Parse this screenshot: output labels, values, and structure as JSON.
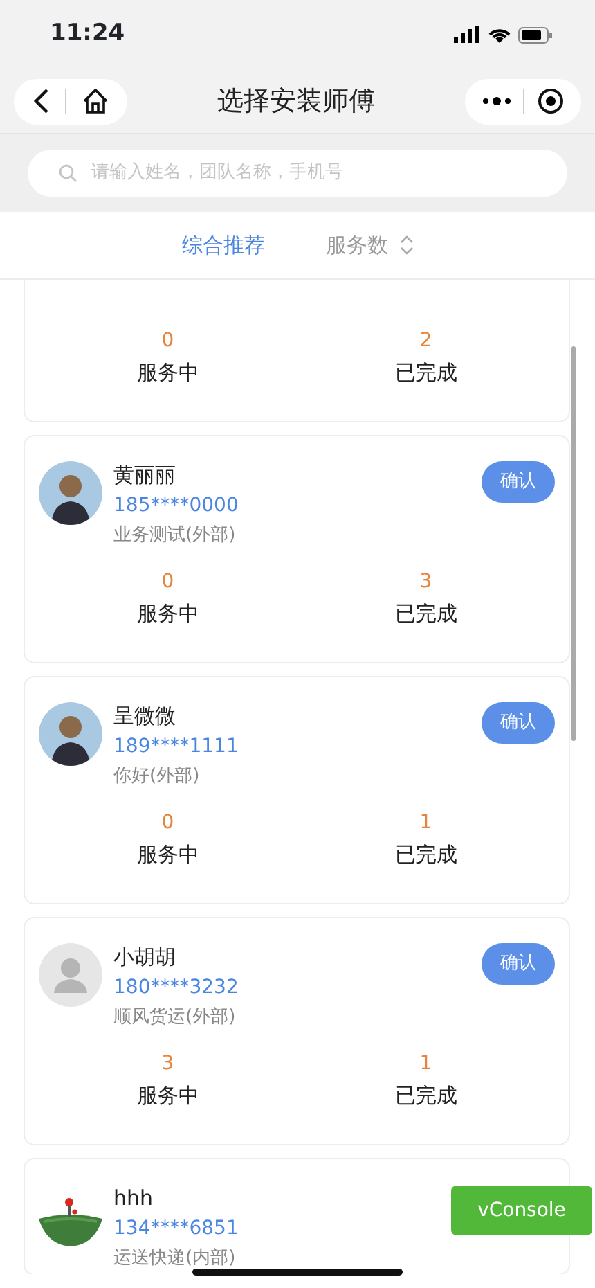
{
  "status_bar": {
    "time": "11:24"
  },
  "nav": {
    "title": "选择安装师傅"
  },
  "search": {
    "placeholder": "请输入姓名，团队名称，手机号"
  },
  "sort_tabs": [
    {
      "label": "综合推荐",
      "selected": true,
      "kind": "plain"
    },
    {
      "label": "服务数",
      "selected": false,
      "kind": "sortable"
    }
  ],
  "workers": [
    {
      "kind": "partial",
      "stats": [
        {
          "value": "0",
          "label": "服务中"
        },
        {
          "value": "2",
          "label": "已完成"
        }
      ]
    },
    {
      "kind": "full",
      "avatar": {
        "kind": "figure"
      },
      "name": "黄丽丽",
      "phone": "185****0000",
      "team": "业务测试(外部)",
      "button": "确认",
      "stats": [
        {
          "value": "0",
          "label": "服务中"
        },
        {
          "value": "3",
          "label": "已完成"
        }
      ]
    },
    {
      "kind": "full",
      "avatar": {
        "kind": "figure"
      },
      "name": "呈微微",
      "phone": "189****1111",
      "team": "你好(外部)",
      "button": "确认",
      "stats": [
        {
          "value": "0",
          "label": "服务中"
        },
        {
          "value": "1",
          "label": "已完成"
        }
      ]
    },
    {
      "kind": "full",
      "avatar": {
        "kind": "default"
      },
      "name": "小胡胡",
      "phone": "180****3232",
      "team": "顺风货运(外部)",
      "button": "确认",
      "stats": [
        {
          "value": "3",
          "label": "服务中"
        },
        {
          "value": "1",
          "label": "已完成"
        }
      ]
    },
    {
      "kind": "full",
      "name": "hhh",
      "phone": "134****6851",
      "team": "运送快递(内部)"
    }
  ],
  "vconsole": {
    "label": "vConsole"
  }
}
